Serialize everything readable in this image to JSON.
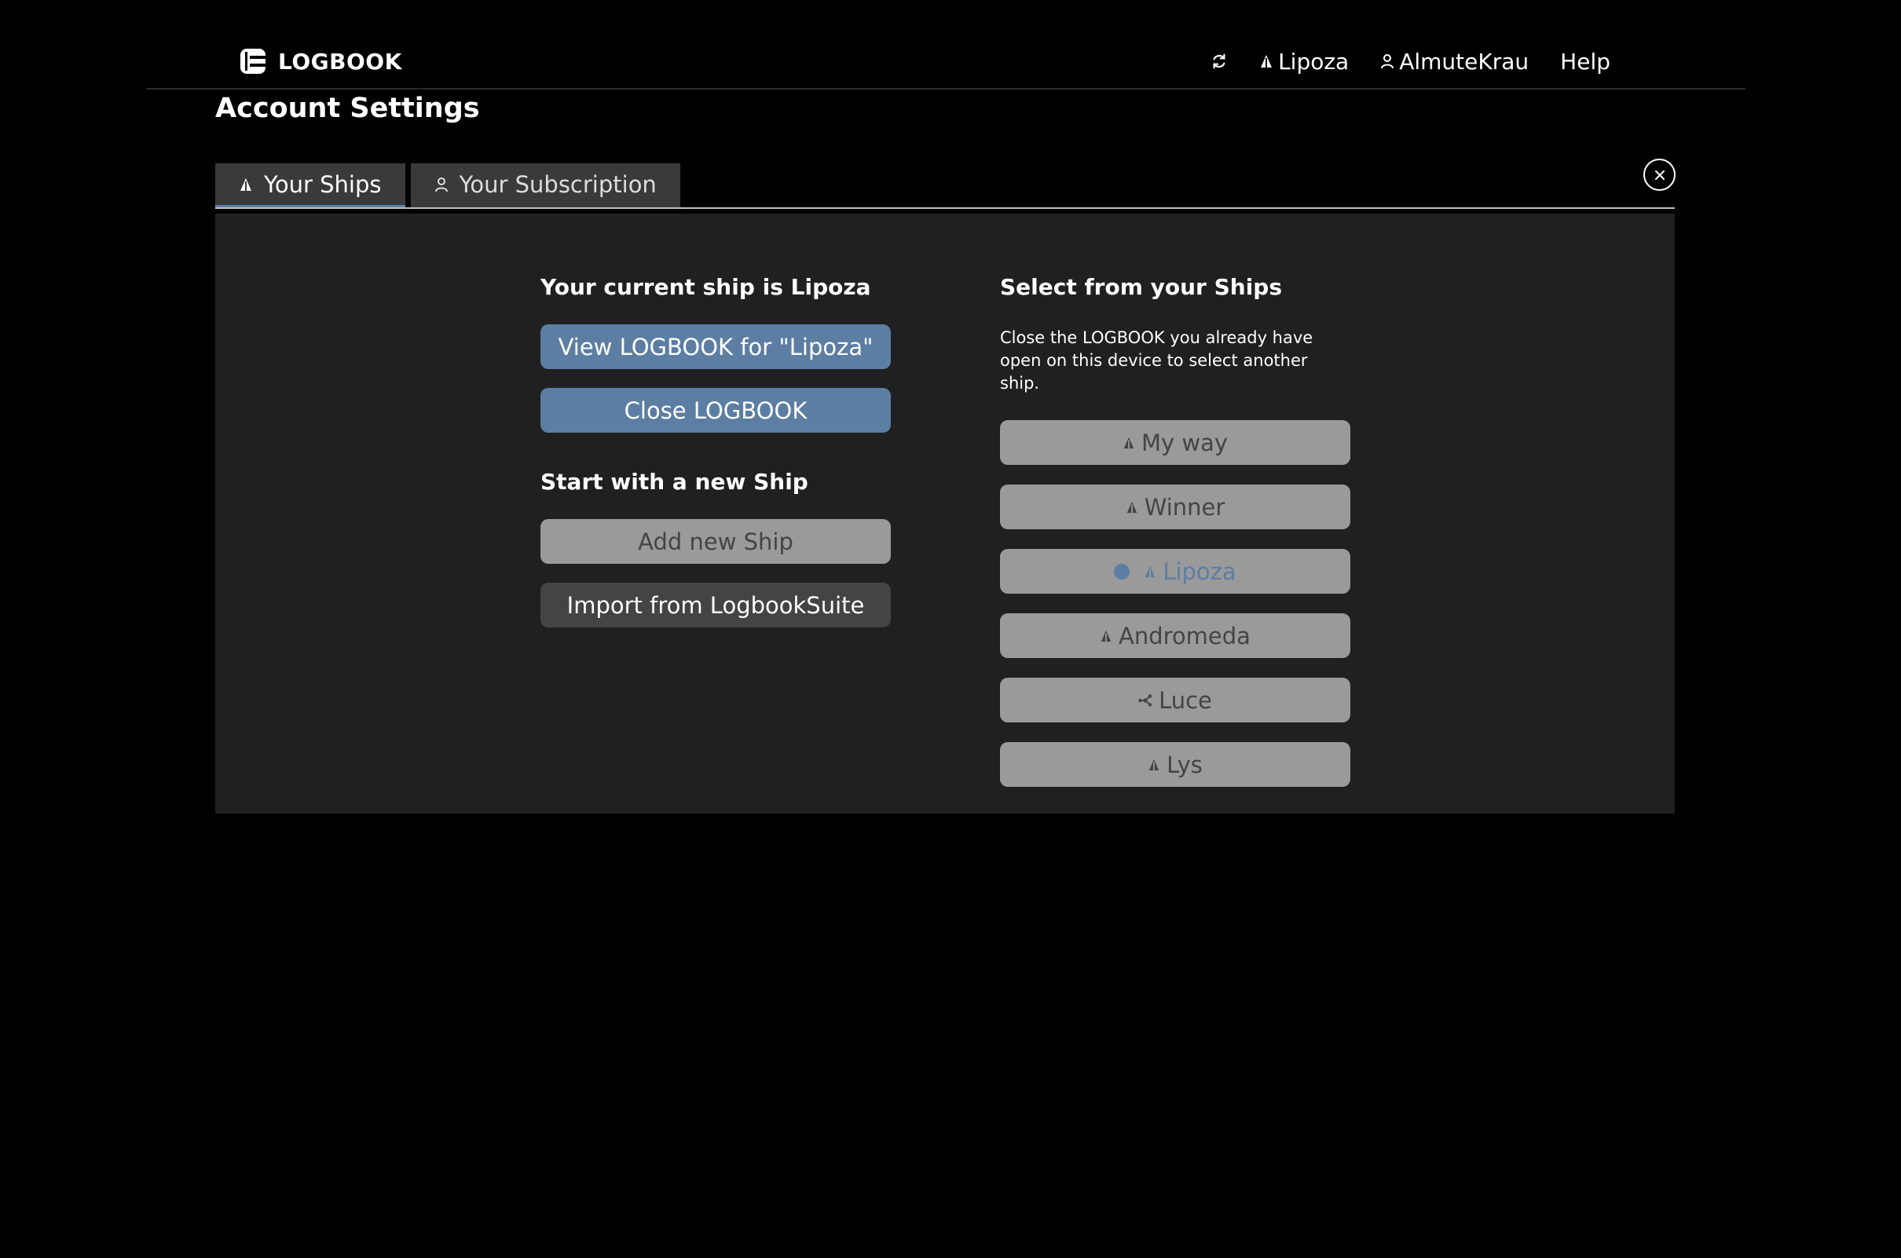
{
  "header": {
    "brand": "LOGBOOK",
    "nav": {
      "ship_label": "Lipoza",
      "user_label": "AlmuteKrau",
      "help_label": "Help"
    }
  },
  "page": {
    "title": "Account Settings"
  },
  "tabs": [
    {
      "label": "Your Ships",
      "active": true
    },
    {
      "label": "Your Subscription",
      "active": false
    }
  ],
  "left": {
    "current_heading": "Your current ship is Lipoza",
    "view_button": "View LOGBOOK for \"Lipoza\"",
    "close_button": "Close LOGBOOK",
    "new_heading": "Start with a new Ship",
    "add_button": "Add new Ship",
    "import_button": "Import from LogbookSuite"
  },
  "right": {
    "heading": "Select from your Ships",
    "hint": "Close the LOGBOOK you already have open on this device to select another ship.",
    "ships": [
      {
        "name": "My way",
        "icon": "sail-icon",
        "current": false
      },
      {
        "name": "Winner",
        "icon": "sail-icon",
        "current": false
      },
      {
        "name": "Lipoza",
        "icon": "sail-icon",
        "current": true
      },
      {
        "name": "Andromeda",
        "icon": "sail-icon",
        "current": false
      },
      {
        "name": "Luce",
        "icon": "motorboat-icon",
        "current": false
      },
      {
        "name": "Lys",
        "icon": "sail-icon",
        "current": false
      }
    ]
  },
  "colors": {
    "accent": "#5d7ea3",
    "panel": "#202020",
    "button_light": "#9a9a9a",
    "button_dark": "#444444",
    "tab": "#3a3a3a"
  }
}
